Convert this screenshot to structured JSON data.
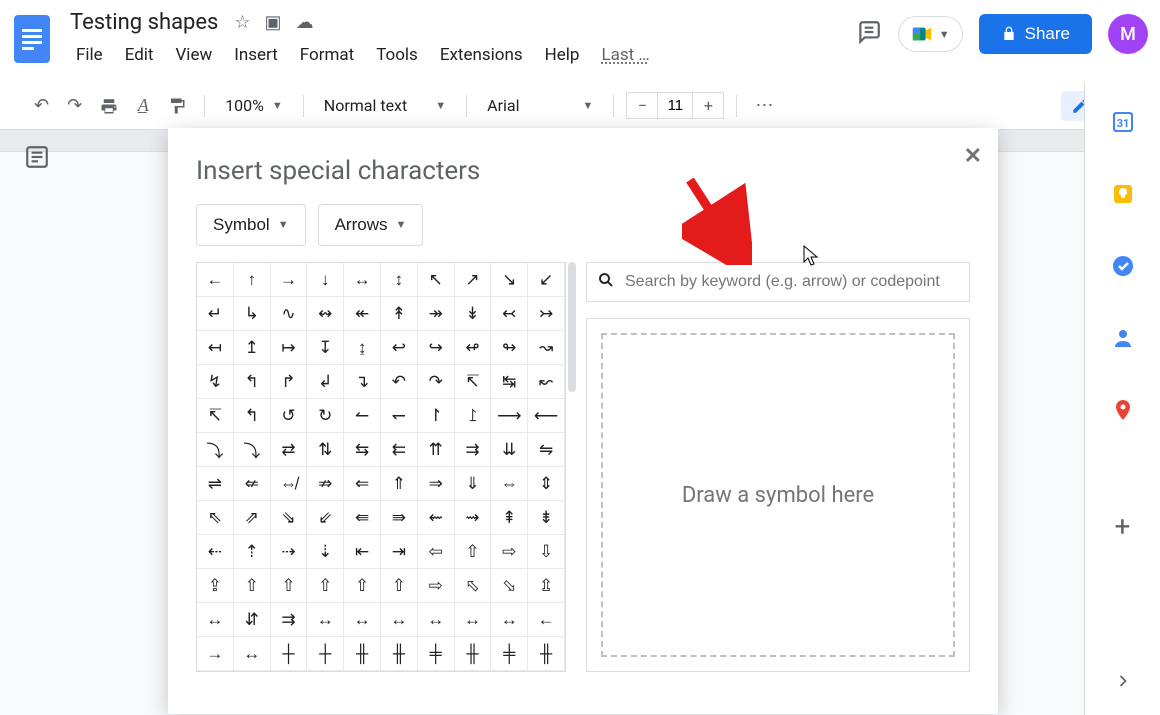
{
  "header": {
    "doc_title": "Testing shapes",
    "menus": [
      "File",
      "Edit",
      "View",
      "Insert",
      "Format",
      "Tools",
      "Extensions",
      "Help"
    ],
    "last_edit": "Last …",
    "share_label": "Share",
    "avatar_initial": "M"
  },
  "toolbar": {
    "zoom": "100%",
    "style": "Normal text",
    "font": "Arial",
    "font_size": "11"
  },
  "dialog": {
    "title": "Insert special characters",
    "category": "Symbol",
    "subcategory": "Arrows",
    "search_placeholder": "Search by keyword (e.g. arrow) or codepoint",
    "draw_hint": "Draw a symbol here",
    "characters": [
      "←",
      "↑",
      "→",
      "↓",
      "↔",
      "↕",
      "↖",
      "↗",
      "↘",
      "↙",
      "↵",
      "↳",
      "∿",
      "↭",
      "↞",
      "↟",
      "↠",
      "↡",
      "↢",
      "↣",
      "↤",
      "↥",
      "↦",
      "↧",
      "↨",
      "↩",
      "↪",
      "↫",
      "↬",
      "↝",
      "↯",
      "↰",
      "↱",
      "↲",
      "↴",
      "↶",
      "↷",
      "↸",
      "↹",
      "↜",
      "↸",
      "↰",
      "↺",
      "↻",
      "↼",
      "↽",
      "↾",
      "⥜",
      "⟶",
      "⟵",
      "⤵",
      "⤵",
      "⇄",
      "⇅",
      "⇆",
      "⇇",
      "⇈",
      "⇉",
      "⇊",
      "⇋",
      "⇌",
      "⇍",
      "⇎",
      "⇏",
      "⇐",
      "⇑",
      "⇒",
      "⇓",
      "⇔",
      "⇕",
      "⇖",
      "⇗",
      "⇘",
      "⇙",
      "⇚",
      "⇛",
      "⇜",
      "⇝",
      "⇞",
      "⇟",
      "⇠",
      "⇡",
      "⇢",
      "⇣",
      "⇤",
      "⇥",
      "⇦",
      "⇧",
      "⇨",
      "⇩",
      "⇪",
      "⇧",
      "⇧",
      "⇧",
      "⇧",
      "⇧",
      "⇨",
      "⬁",
      "⬂",
      "⇫",
      "↔",
      "⇵",
      "⇉",
      "↔",
      "↔",
      "↔",
      "↔",
      "↔",
      "↔",
      "←",
      "→",
      "↔",
      "┼",
      "┼",
      "╫",
      "╫",
      "╪",
      "╫",
      "╪",
      "╫"
    ]
  },
  "side_panel": {
    "apps": [
      "calendar",
      "keep",
      "tasks",
      "contacts",
      "maps"
    ]
  }
}
